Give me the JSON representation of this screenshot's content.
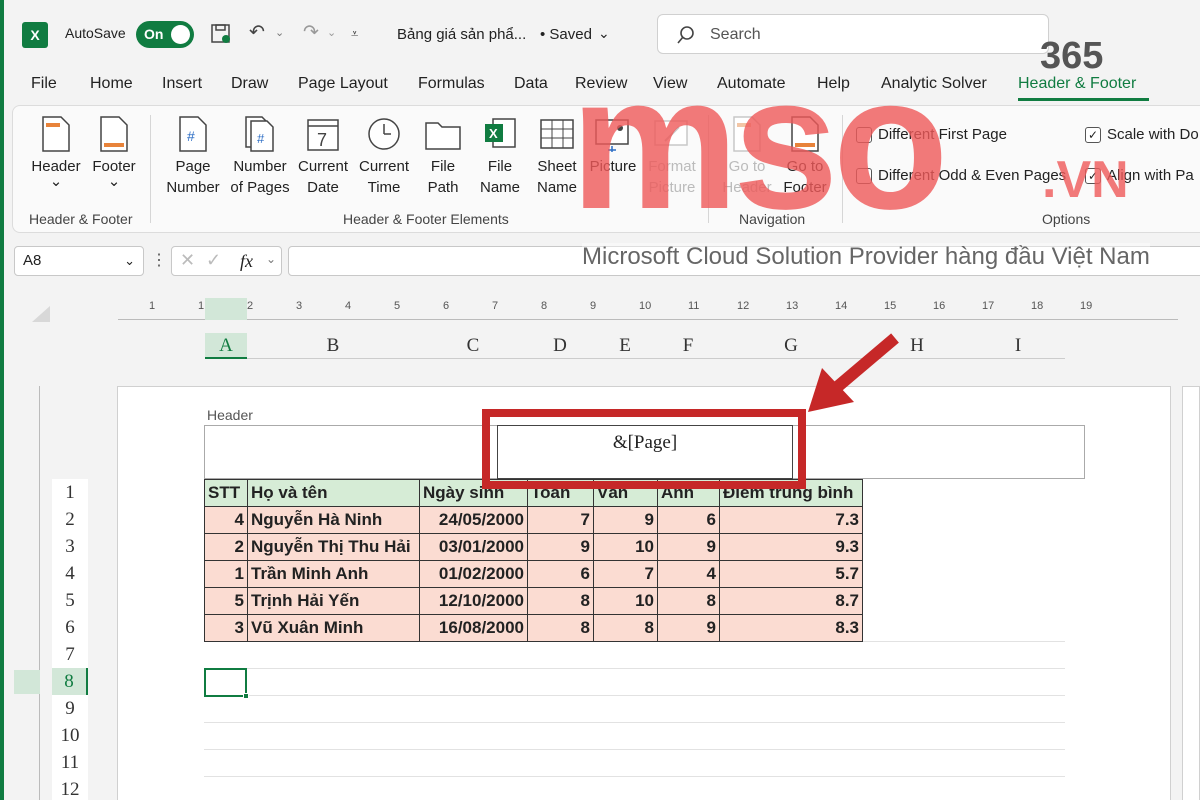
{
  "title_bar": {
    "autosave_label": "AutoSave",
    "autosave_state": "On",
    "filename": "Bảng giá sản phẩ...",
    "save_status": "• Saved",
    "search_placeholder": "Search"
  },
  "tabs": [
    "File",
    "Home",
    "Insert",
    "Draw",
    "Page Layout",
    "Formulas",
    "Data",
    "Review",
    "View",
    "Automate",
    "Help",
    "Analytic Solver",
    "Header & Footer"
  ],
  "ribbon": {
    "groups": {
      "hf": "Header & Footer",
      "elements": "Header & Footer Elements",
      "navigation": "Navigation",
      "options": "Options"
    },
    "buttons": {
      "header": [
        "Header",
        "⌄"
      ],
      "footer": [
        "Footer",
        "⌄"
      ],
      "page_number": [
        "Page",
        "Number"
      ],
      "number_of_pages": [
        "Number",
        "of Pages"
      ],
      "current_date": [
        "Current",
        "Date"
      ],
      "current_time": [
        "Current",
        "Time"
      ],
      "file_path": [
        "File",
        "Path"
      ],
      "file_name": [
        "File",
        "Name"
      ],
      "sheet_name": [
        "Sheet",
        "Name"
      ],
      "picture": [
        "Picture",
        ""
      ],
      "format_picture": [
        "Format",
        "Picture"
      ],
      "go_header": [
        "Go to",
        "Header"
      ],
      "go_footer": [
        "Go to",
        "Footer"
      ]
    },
    "options": {
      "diff_first": "Different First Page",
      "diff_odd_even": "Different Odd & Even Pages",
      "scale_doc": "Scale with Do",
      "align_margins": "Align with Pa"
    }
  },
  "formula_bar": {
    "name_box": "A8",
    "fx": "fx"
  },
  "ruler_marks": [
    "1",
    "1",
    "2",
    "3",
    "4",
    "5",
    "6",
    "7",
    "8",
    "9",
    "10",
    "11",
    "12",
    "13",
    "14",
    "15",
    "16",
    "17",
    "18",
    "19"
  ],
  "columns": [
    "A",
    "B",
    "C",
    "D",
    "E",
    "F",
    "G",
    "H",
    "I"
  ],
  "rows": [
    "1",
    "2",
    "3",
    "4",
    "5",
    "6",
    "7",
    "8",
    "9",
    "10",
    "11",
    "12"
  ],
  "header_area": {
    "label": "Header",
    "center_field": "&[Page]"
  },
  "table": {
    "headers": [
      "STT",
      "Họ và tên",
      "Ngày sinh",
      "Toán",
      "Văn",
      "Anh",
      "Điểm trung bình"
    ],
    "rows": [
      [
        "4",
        "Nguyễn Hà Ninh",
        "24/05/2000",
        "7",
        "9",
        "6",
        "7.3"
      ],
      [
        "2",
        "Nguyễn Thị Thu Hải",
        "03/01/2000",
        "9",
        "10",
        "9",
        "9.3"
      ],
      [
        "1",
        "Trần Minh Anh",
        "01/02/2000",
        "6",
        "7",
        "4",
        "5.7"
      ],
      [
        "5",
        "Trịnh Hải Yến",
        "12/10/2000",
        "8",
        "10",
        "8",
        "8.7"
      ],
      [
        "3",
        "Vũ Xuân Minh",
        "16/08/2000",
        "8",
        "8",
        "9",
        "8.3"
      ]
    ]
  },
  "watermark": {
    "brand": "mso",
    "suffix_365": "365",
    "suffix_vn": ".VN",
    "tagline": "Microsoft Cloud Solution Provider hàng đầu Việt Nam"
  },
  "colors": {
    "excel_green": "#107c41",
    "highlight_red": "#c62828",
    "header_fill": "#d6ecd6",
    "data_fill": "#fbdcd2"
  }
}
